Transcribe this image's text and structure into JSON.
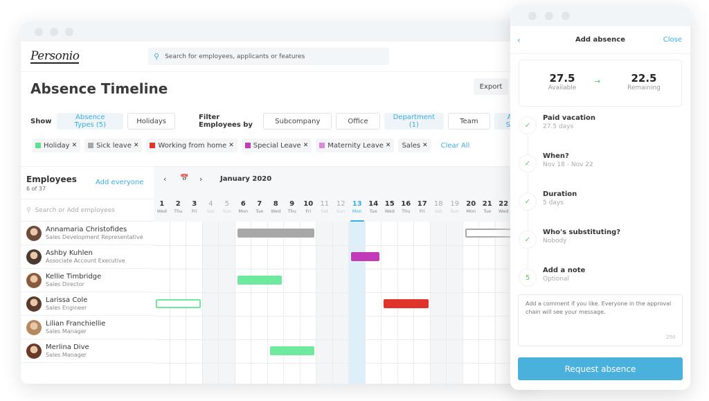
{
  "app": {
    "logo": "Personio",
    "search_placeholder": "Search for employees, applicants or features",
    "page_title": "Absence Timeline",
    "export_label": "Export"
  },
  "filters": {
    "show_label": "Show",
    "show_buttons": [
      {
        "label": "Absence Types (5)",
        "active": true
      },
      {
        "label": "Holidays",
        "active": false
      }
    ],
    "filter_label": "Filter Employees by",
    "filter_buttons": [
      {
        "label": "Subcompany",
        "active": false
      },
      {
        "label": "Office",
        "active": false
      },
      {
        "label": "Department (1)",
        "active": true
      },
      {
        "label": "Team",
        "active": false
      },
      {
        "label": "All Sta",
        "active": true
      }
    ],
    "chips": [
      {
        "label": "Holiday",
        "color": "#5fe08f"
      },
      {
        "label": "Sick leave",
        "color": "#a8a8a8"
      },
      {
        "label": "Working from home",
        "color": "#e0332a"
      },
      {
        "label": "Special Leave",
        "color": "#c13ab8"
      },
      {
        "label": "Maternity Leave",
        "color": "#d98ad6"
      },
      {
        "label": "Sales",
        "color": null
      }
    ],
    "clear_all": "Clear All"
  },
  "employees_panel": {
    "title": "Employees",
    "count": "6 of 37",
    "add_everyone": "Add everyone",
    "search_placeholder": "Search or Add employees",
    "rows": [
      {
        "name": "Annamaria Christofides",
        "role": "Sales Development Representative",
        "avatar_color": "#6b4a3a"
      },
      {
        "name": "Ashby Kuhlen",
        "role": "Associate Account Executive",
        "avatar_color": "#4a3a30"
      },
      {
        "name": "Kellie Timbridge",
        "role": "Sales Director",
        "avatar_color": "#8a5a40"
      },
      {
        "name": "Larissa Cole",
        "role": "Sales Engineer",
        "avatar_color": "#5a3a2a"
      },
      {
        "name": "Lilian Franchiellie",
        "role": "Sales Manager",
        "avatar_color": "#b58a60"
      },
      {
        "name": "Merlina Dive",
        "role": "Sales Manager",
        "avatar_color": "#6a3a28"
      }
    ]
  },
  "timeline": {
    "month": "January 2020",
    "today": 13,
    "days": [
      {
        "n": "1",
        "wd": "Wed",
        "we": false
      },
      {
        "n": "2",
        "wd": "Thu",
        "we": false
      },
      {
        "n": "3",
        "wd": "Fri",
        "we": false
      },
      {
        "n": "4",
        "wd": "Sat",
        "we": true
      },
      {
        "n": "5",
        "wd": "Sun",
        "we": true
      },
      {
        "n": "6",
        "wd": "Mon",
        "we": false
      },
      {
        "n": "7",
        "wd": "Tue",
        "we": false
      },
      {
        "n": "8",
        "wd": "Wed",
        "we": false
      },
      {
        "n": "9",
        "wd": "Thu",
        "we": false
      },
      {
        "n": "10",
        "wd": "Fri",
        "we": false
      },
      {
        "n": "11",
        "wd": "Sat",
        "we": true
      },
      {
        "n": "12",
        "wd": "Sun",
        "we": true
      },
      {
        "n": "13",
        "wd": "Mon",
        "we": false
      },
      {
        "n": "14",
        "wd": "Tue",
        "we": false
      },
      {
        "n": "15",
        "wd": "Wed",
        "we": false
      },
      {
        "n": "16",
        "wd": "Thu",
        "we": false
      },
      {
        "n": "17",
        "wd": "Fri",
        "we": false
      },
      {
        "n": "18",
        "wd": "Sat",
        "we": true
      },
      {
        "n": "19",
        "wd": "Sun",
        "we": true
      },
      {
        "n": "20",
        "wd": "Mon",
        "we": false
      },
      {
        "n": "21",
        "wd": "Tue",
        "we": false
      },
      {
        "n": "22",
        "wd": "Wed",
        "we": false
      }
    ],
    "absences": [
      {
        "row": 0,
        "start": 6,
        "end": 10,
        "type": "Sick leave",
        "color": "#a8a8a8",
        "outline": false
      },
      {
        "row": 0,
        "start": 20,
        "end": 23,
        "type": "Sick leave",
        "color": "#a8a8a8",
        "outline": true
      },
      {
        "row": 1,
        "start": 13,
        "end": 14,
        "type": "Special Leave",
        "color": "#c13ab8",
        "outline": false
      },
      {
        "row": 2,
        "start": 6,
        "end": 8,
        "type": "Holiday",
        "color": "#6eea9e",
        "outline": false
      },
      {
        "row": 3,
        "start": 1,
        "end": 3,
        "type": "Holiday",
        "color": "#6eea9e",
        "outline": true
      },
      {
        "row": 3,
        "start": 15,
        "end": 17,
        "type": "Working from home",
        "color": "#e0332a",
        "outline": false
      },
      {
        "row": 5,
        "start": 8,
        "end": 10,
        "type": "Holiday",
        "color": "#6eea9e",
        "outline": false
      }
    ]
  },
  "side_panel": {
    "title": "Add absence",
    "close": "Close",
    "available_value": "27.5",
    "available_label": "Available",
    "remaining_value": "22.5",
    "remaining_label": "Remaining",
    "steps": [
      {
        "title": "Paid vacation",
        "sub": "27.5 days",
        "marker": "✓"
      },
      {
        "title": "When?",
        "sub": "Nov 18 - Nov 22",
        "marker": "✓"
      },
      {
        "title": "Duration",
        "sub": "5 days",
        "marker": "✓"
      },
      {
        "title": "Who's substituting?",
        "sub": "Nobody",
        "marker": "✓"
      },
      {
        "title": "Add a note",
        "sub": "Optional",
        "marker": "5"
      }
    ],
    "note_placeholder": "Add a comment if you like. Everyone in the approval chain will see your message.",
    "char_counter": "250",
    "submit_label": "Request absence"
  }
}
